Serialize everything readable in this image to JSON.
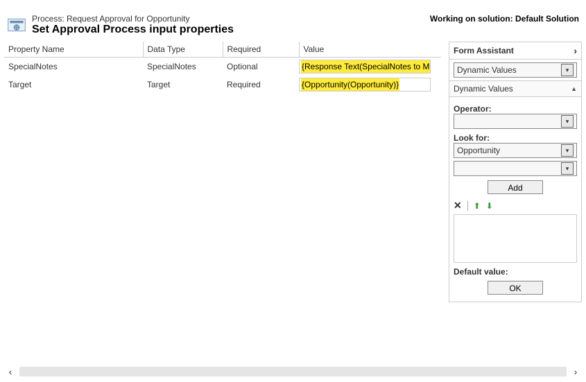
{
  "header": {
    "process_line": "Process: Request Approval for Opportunity",
    "title": "Set Approval Process input properties",
    "solution_line": "Working on solution: Default Solution"
  },
  "table": {
    "columns": {
      "name": "Property Name",
      "type": "Data Type",
      "required": "Required",
      "value": "Value"
    },
    "rows": [
      {
        "name": "SpecialNotes",
        "type": "SpecialNotes",
        "required": "Optional",
        "value_token": "{Response Text(SpecialNotes to Manager)}"
      },
      {
        "name": "Target",
        "type": "Target",
        "required": "Required",
        "value_token": "{Opportunity(Opportunity)}"
      }
    ]
  },
  "assistant": {
    "title": "Form Assistant",
    "top_dropdown": "Dynamic Values",
    "section_title": "Dynamic Values",
    "operator_label": "Operator:",
    "operator_value": "",
    "lookfor_label": "Look for:",
    "lookfor_value1": "Opportunity",
    "lookfor_value2": "",
    "add_label": "Add",
    "default_label": "Default value:",
    "ok_label": "OK"
  },
  "icons": {
    "chevron_right": "›",
    "chevron_left": "‹",
    "collapse_up": "▲",
    "dropdown": "▾",
    "delete": "✕",
    "arrow_up": "⬆",
    "arrow_down": "⬇"
  }
}
